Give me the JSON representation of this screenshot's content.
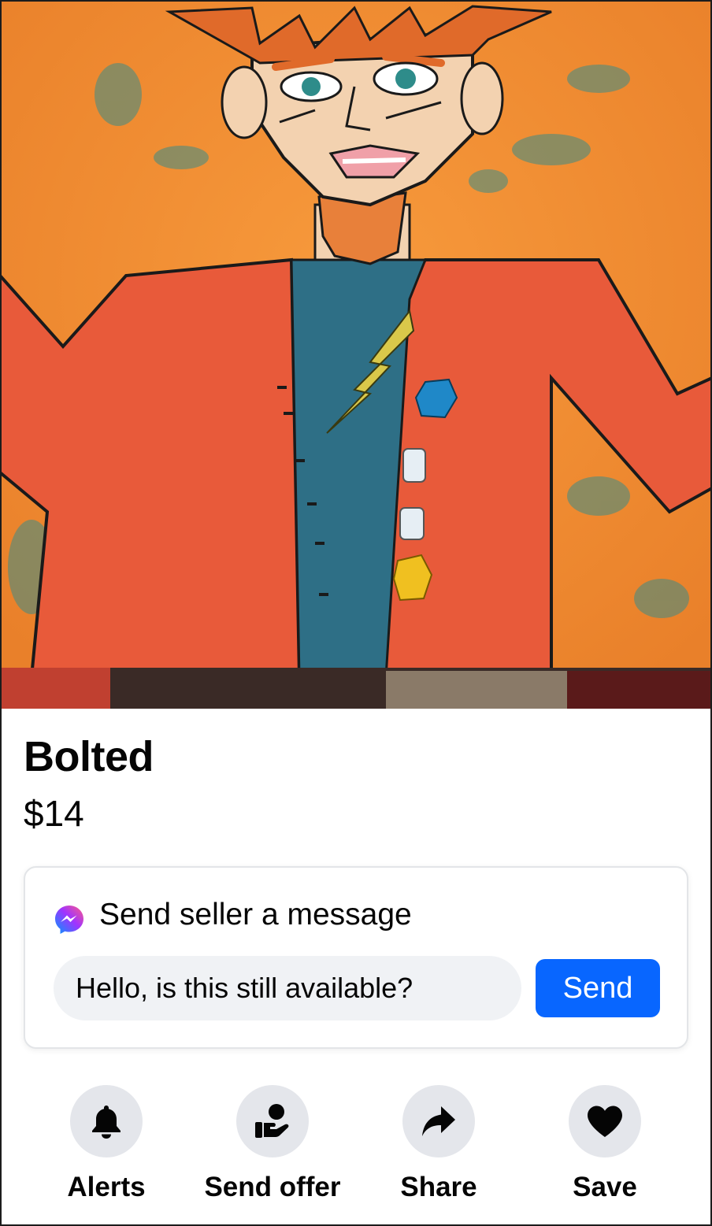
{
  "listing": {
    "title": "Bolted",
    "price": "$14",
    "photo_icon": "listing-photo-painting"
  },
  "message": {
    "heading": "Send seller a message",
    "input_value": "Hello, is this still available?",
    "send_label": "Send",
    "icon": "messenger-icon"
  },
  "actions": [
    {
      "label": "Alerts",
      "icon": "bell-icon"
    },
    {
      "label": "Send offer",
      "icon": "offer-icon"
    },
    {
      "label": "Share",
      "icon": "share-arrow-icon"
    },
    {
      "label": "Save",
      "icon": "heart-icon"
    }
  ],
  "colors": {
    "accent": "#0866ff",
    "icon_circle": "#e4e6eb",
    "input_bg": "#f0f2f5",
    "text": "#050505"
  }
}
